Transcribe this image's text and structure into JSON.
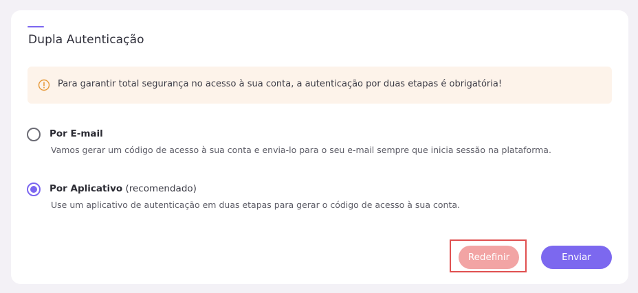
{
  "section": {
    "title": "Dupla Autenticação"
  },
  "alert": {
    "icon": "warning-circle-icon",
    "text": "Para garantir total segurança no acesso à sua conta, a autenticação por duas etapas é obrigatória!"
  },
  "options": [
    {
      "label": "Por E-mail",
      "hint": "",
      "description": "Vamos gerar um código de acesso à sua conta e envia-lo para o seu e-mail sempre que inicia sessão na plataforma.",
      "selected": false
    },
    {
      "label": "Por Aplicativo",
      "hint": "(recomendado)",
      "description": "Use um aplicativo de autenticação em duas etapas para gerar o código de acesso à sua conta.",
      "selected": true
    }
  ],
  "actions": {
    "reset_label": "Redefinir",
    "send_label": "Enviar"
  },
  "colors": {
    "accent": "#7b66f0",
    "reset": "#f2a4a4",
    "alert_bg": "#fdf3ea",
    "warning": "#e79a3a",
    "highlight": "#e05050"
  }
}
